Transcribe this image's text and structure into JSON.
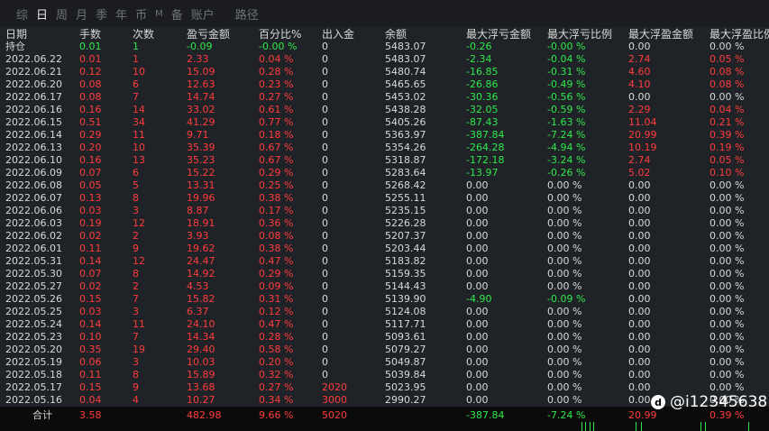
{
  "tabs": [
    {
      "label": "综",
      "active": false,
      "small": false
    },
    {
      "label": "日",
      "active": true,
      "small": false
    },
    {
      "label": "周",
      "active": false,
      "small": false
    },
    {
      "label": "月",
      "active": false,
      "small": false
    },
    {
      "label": "季",
      "active": false,
      "small": false
    },
    {
      "label": "年",
      "active": false,
      "small": false
    },
    {
      "label": "币",
      "active": false,
      "small": false
    },
    {
      "label": "M",
      "active": false,
      "small": true
    },
    {
      "label": "备",
      "active": false,
      "small": false
    },
    {
      "label": "账户",
      "active": false,
      "small": false
    },
    {
      "label": "路径",
      "active": false,
      "small": false,
      "gap": true
    }
  ],
  "headers": [
    "日期",
    "手数",
    "次数",
    "盈亏金额",
    "百分比%",
    "出入金",
    "余额",
    "最大浮亏金额",
    "最大浮亏比例",
    "最大浮盈金额",
    "最大浮盈比例"
  ],
  "rows": [
    {
      "date": "持仓",
      "lots": "0.01",
      "count": "1",
      "pnl": "-0.09",
      "pct": "-0.00 %",
      "flow": "0",
      "bal": "5483.07",
      "mfl": "-0.26",
      "mflp": "-0.00 %",
      "mfp": "0.00",
      "mfpp": "0.00 %",
      "tone": "green"
    },
    {
      "date": "2022.06.22",
      "lots": "0.01",
      "count": "1",
      "pnl": "2.33",
      "pct": "0.04 %",
      "flow": "0",
      "bal": "5483.07",
      "mfl": "-2.34",
      "mflp": "-0.04 %",
      "mfp": "2.74",
      "mfpp": "0.05 %",
      "tone": "red"
    },
    {
      "date": "2022.06.21",
      "lots": "0.12",
      "count": "10",
      "pnl": "15.09",
      "pct": "0.28 %",
      "flow": "0",
      "bal": "5480.74",
      "mfl": "-16.85",
      "mflp": "-0.31 %",
      "mfp": "4.60",
      "mfpp": "0.08 %",
      "tone": "red"
    },
    {
      "date": "2022.06.20",
      "lots": "0.08",
      "count": "6",
      "pnl": "12.63",
      "pct": "0.23 %",
      "flow": "0",
      "bal": "5465.65",
      "mfl": "-26.86",
      "mflp": "-0.49 %",
      "mfp": "4.10",
      "mfpp": "0.08 %",
      "tone": "red"
    },
    {
      "date": "2022.06.17",
      "lots": "0.08",
      "count": "7",
      "pnl": "14.74",
      "pct": "0.27 %",
      "flow": "0",
      "bal": "5453.02",
      "mfl": "-30.36",
      "mflp": "-0.56 %",
      "mfp": "0.00",
      "mfpp": "0.00 %",
      "tone": "red"
    },
    {
      "date": "2022.06.16",
      "lots": "0.16",
      "count": "14",
      "pnl": "33.02",
      "pct": "0.61 %",
      "flow": "0",
      "bal": "5438.28",
      "mfl": "-32.05",
      "mflp": "-0.59 %",
      "mfp": "2.29",
      "mfpp": "0.04 %",
      "tone": "red"
    },
    {
      "date": "2022.06.15",
      "lots": "0.51",
      "count": "34",
      "pnl": "41.29",
      "pct": "0.77 %",
      "flow": "0",
      "bal": "5405.26",
      "mfl": "-87.43",
      "mflp": "-1.63 %",
      "mfp": "11.04",
      "mfpp": "0.21 %",
      "tone": "red"
    },
    {
      "date": "2022.06.14",
      "lots": "0.29",
      "count": "11",
      "pnl": "9.71",
      "pct": "0.18 %",
      "flow": "0",
      "bal": "5363.97",
      "mfl": "-387.84",
      "mflp": "-7.24 %",
      "mfp": "20.99",
      "mfpp": "0.39 %",
      "tone": "red"
    },
    {
      "date": "2022.06.13",
      "lots": "0.20",
      "count": "10",
      "pnl": "35.39",
      "pct": "0.67 %",
      "flow": "0",
      "bal": "5354.26",
      "mfl": "-264.28",
      "mflp": "-4.94 %",
      "mfp": "10.19",
      "mfpp": "0.19 %",
      "tone": "red"
    },
    {
      "date": "2022.06.10",
      "lots": "0.16",
      "count": "13",
      "pnl": "35.23",
      "pct": "0.67 %",
      "flow": "0",
      "bal": "5318.87",
      "mfl": "-172.18",
      "mflp": "-3.24 %",
      "mfp": "2.74",
      "mfpp": "0.05 %",
      "tone": "red"
    },
    {
      "date": "2022.06.09",
      "lots": "0.07",
      "count": "6",
      "pnl": "15.22",
      "pct": "0.29 %",
      "flow": "0",
      "bal": "5283.64",
      "mfl": "-13.97",
      "mflp": "-0.26 %",
      "mfp": "5.02",
      "mfpp": "0.10 %",
      "tone": "red"
    },
    {
      "date": "2022.06.08",
      "lots": "0.05",
      "count": "5",
      "pnl": "13.31",
      "pct": "0.25 %",
      "flow": "0",
      "bal": "5268.42",
      "mfl": "0.00",
      "mflp": "0.00 %",
      "mfp": "0.00",
      "mfpp": "0.00 %",
      "tone": "red"
    },
    {
      "date": "2022.06.07",
      "lots": "0.13",
      "count": "8",
      "pnl": "19.96",
      "pct": "0.38 %",
      "flow": "0",
      "bal": "5255.11",
      "mfl": "0.00",
      "mflp": "0.00 %",
      "mfp": "0.00",
      "mfpp": "0.00 %",
      "tone": "red"
    },
    {
      "date": "2022.06.06",
      "lots": "0.03",
      "count": "3",
      "pnl": "8.87",
      "pct": "0.17 %",
      "flow": "0",
      "bal": "5235.15",
      "mfl": "0.00",
      "mflp": "0.00 %",
      "mfp": "0.00",
      "mfpp": "0.00 %",
      "tone": "red"
    },
    {
      "date": "2022.06.03",
      "lots": "0.19",
      "count": "12",
      "pnl": "18.91",
      "pct": "0.36 %",
      "flow": "0",
      "bal": "5226.28",
      "mfl": "0.00",
      "mflp": "0.00 %",
      "mfp": "0.00",
      "mfpp": "0.00 %",
      "tone": "red"
    },
    {
      "date": "2022.06.02",
      "lots": "0.02",
      "count": "2",
      "pnl": "3.93",
      "pct": "0.08 %",
      "flow": "0",
      "bal": "5207.37",
      "mfl": "0.00",
      "mflp": "0.00 %",
      "mfp": "0.00",
      "mfpp": "0.00 %",
      "tone": "red"
    },
    {
      "date": "2022.06.01",
      "lots": "0.11",
      "count": "9",
      "pnl": "19.62",
      "pct": "0.38 %",
      "flow": "0",
      "bal": "5203.44",
      "mfl": "0.00",
      "mflp": "0.00 %",
      "mfp": "0.00",
      "mfpp": "0.00 %",
      "tone": "red"
    },
    {
      "date": "2022.05.31",
      "lots": "0.14",
      "count": "12",
      "pnl": "24.47",
      "pct": "0.47 %",
      "flow": "0",
      "bal": "5183.82",
      "mfl": "0.00",
      "mflp": "0.00 %",
      "mfp": "0.00",
      "mfpp": "0.00 %",
      "tone": "red"
    },
    {
      "date": "2022.05.30",
      "lots": "0.07",
      "count": "8",
      "pnl": "14.92",
      "pct": "0.29 %",
      "flow": "0",
      "bal": "5159.35",
      "mfl": "0.00",
      "mflp": "0.00 %",
      "mfp": "0.00",
      "mfpp": "0.00 %",
      "tone": "red"
    },
    {
      "date": "2022.05.27",
      "lots": "0.02",
      "count": "2",
      "pnl": "4.53",
      "pct": "0.09 %",
      "flow": "0",
      "bal": "5144.43",
      "mfl": "0.00",
      "mflp": "0.00 %",
      "mfp": "0.00",
      "mfpp": "0.00 %",
      "tone": "red"
    },
    {
      "date": "2022.05.26",
      "lots": "0.15",
      "count": "7",
      "pnl": "15.82",
      "pct": "0.31 %",
      "flow": "0",
      "bal": "5139.90",
      "mfl": "-4.90",
      "mflp": "-0.09 %",
      "mfp": "0.00",
      "mfpp": "0.00 %",
      "tone": "red"
    },
    {
      "date": "2022.05.25",
      "lots": "0.03",
      "count": "3",
      "pnl": "6.37",
      "pct": "0.12 %",
      "flow": "0",
      "bal": "5124.08",
      "mfl": "0.00",
      "mflp": "0.00 %",
      "mfp": "0.00",
      "mfpp": "0.00 %",
      "tone": "red"
    },
    {
      "date": "2022.05.24",
      "lots": "0.14",
      "count": "11",
      "pnl": "24.10",
      "pct": "0.47 %",
      "flow": "0",
      "bal": "5117.71",
      "mfl": "0.00",
      "mflp": "0.00 %",
      "mfp": "0.00",
      "mfpp": "0.00 %",
      "tone": "red"
    },
    {
      "date": "2022.05.23",
      "lots": "0.10",
      "count": "7",
      "pnl": "14.34",
      "pct": "0.28 %",
      "flow": "0",
      "bal": "5093.61",
      "mfl": "0.00",
      "mflp": "0.00 %",
      "mfp": "0.00",
      "mfpp": "0.00 %",
      "tone": "red"
    },
    {
      "date": "2022.05.20",
      "lots": "0.35",
      "count": "19",
      "pnl": "29.40",
      "pct": "0.58 %",
      "flow": "0",
      "bal": "5079.27",
      "mfl": "0.00",
      "mflp": "0.00 %",
      "mfp": "0.00",
      "mfpp": "0.00 %",
      "tone": "red"
    },
    {
      "date": "2022.05.19",
      "lots": "0.06",
      "count": "3",
      "pnl": "10.03",
      "pct": "0.20 %",
      "flow": "0",
      "bal": "5049.87",
      "mfl": "0.00",
      "mflp": "0.00 %",
      "mfp": "0.00",
      "mfpp": "0.00 %",
      "tone": "red"
    },
    {
      "date": "2022.05.18",
      "lots": "0.11",
      "count": "8",
      "pnl": "15.89",
      "pct": "0.32 %",
      "flow": "0",
      "bal": "5039.84",
      "mfl": "0.00",
      "mflp": "0.00 %",
      "mfp": "0.00",
      "mfpp": "0.00 %",
      "tone": "red"
    },
    {
      "date": "2022.05.17",
      "lots": "0.15",
      "count": "9",
      "pnl": "13.68",
      "pct": "0.27 %",
      "flow": "2020",
      "bal": "5023.95",
      "mfl": "0.00",
      "mflp": "0.00 %",
      "mfp": "0.00",
      "mfpp": "0.00 %",
      "tone": "red"
    },
    {
      "date": "2022.05.16",
      "lots": "0.04",
      "count": "4",
      "pnl": "10.27",
      "pct": "0.34 %",
      "flow": "3000",
      "bal": "2990.27",
      "mfl": "0.00",
      "mflp": "0.00 %",
      "mfp": "0.00",
      "mfpp": "0.00 %",
      "tone": "red"
    }
  ],
  "totals": {
    "label": "合计",
    "lots": "3.58",
    "pnl": "482.98",
    "pct": "9.66 %",
    "flow": "5020",
    "mfl": "-387.84",
    "mflp": "-7.24 %",
    "mfp": "20.99",
    "mfpp": "0.39 %"
  },
  "watermark": {
    "logo": "d",
    "handle": "@i12345638"
  }
}
